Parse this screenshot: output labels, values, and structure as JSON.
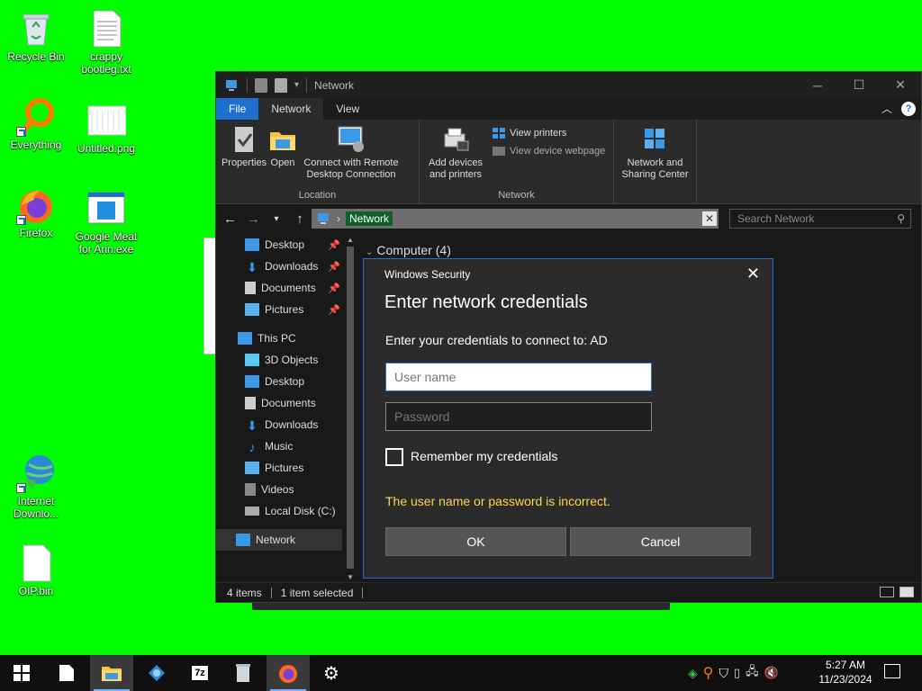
{
  "desktop": {
    "icons": [
      {
        "label": "Recycle Bin"
      },
      {
        "label": "crappy bootleg.txt"
      },
      {
        "label": "Everything"
      },
      {
        "label": "Untitled.png"
      },
      {
        "label": "Firefox"
      },
      {
        "label": "Google Meat for Arin.exe"
      },
      {
        "label": "Internet Downlo..."
      },
      {
        "label": "OIP.bin"
      }
    ]
  },
  "explorer": {
    "title": "Network",
    "tabs": {
      "file": "File",
      "network": "Network",
      "view": "View"
    },
    "ribbon": {
      "properties": "Properties",
      "open": "Open",
      "remote_desktop": "Connect with Remote Desktop Connection",
      "location_group": "Location",
      "add_devices": "Add devices and printers",
      "view_printers": "View printers",
      "view_device_webpage": "View device webpage",
      "network_group": "Network",
      "sharing_center": "Network and Sharing Center"
    },
    "address": {
      "path": "Network",
      "search_placeholder": "Search Network"
    },
    "nav": {
      "desktop": "Desktop",
      "downloads": "Downloads",
      "documents": "Documents",
      "pictures": "Pictures",
      "this_pc": "This PC",
      "objects3d": "3D Objects",
      "pc_desktop": "Desktop",
      "pc_documents": "Documents",
      "pc_downloads": "Downloads",
      "music": "Music",
      "pc_pictures": "Pictures",
      "videos": "Videos",
      "local_disk": "Local Disk (C:)",
      "network": "Network"
    },
    "content_header": "Computer (4)",
    "status": {
      "items": "4 items",
      "selected": "1 item selected"
    }
  },
  "dialog": {
    "caption": "Windows Security",
    "title": "Enter network credentials",
    "message": "Enter your credentials to connect to: AD",
    "username_placeholder": "User name",
    "password_placeholder": "Password",
    "remember": "Remember my credentials",
    "error": "The user name or password is incorrect.",
    "ok": "OK",
    "cancel": "Cancel"
  },
  "taskbar": {
    "time": "5:27 AM",
    "date": "11/23/2024"
  },
  "colors": {
    "desktop": "#00ff00",
    "accent": "#1f6fd1",
    "error": "#ffd64d"
  }
}
